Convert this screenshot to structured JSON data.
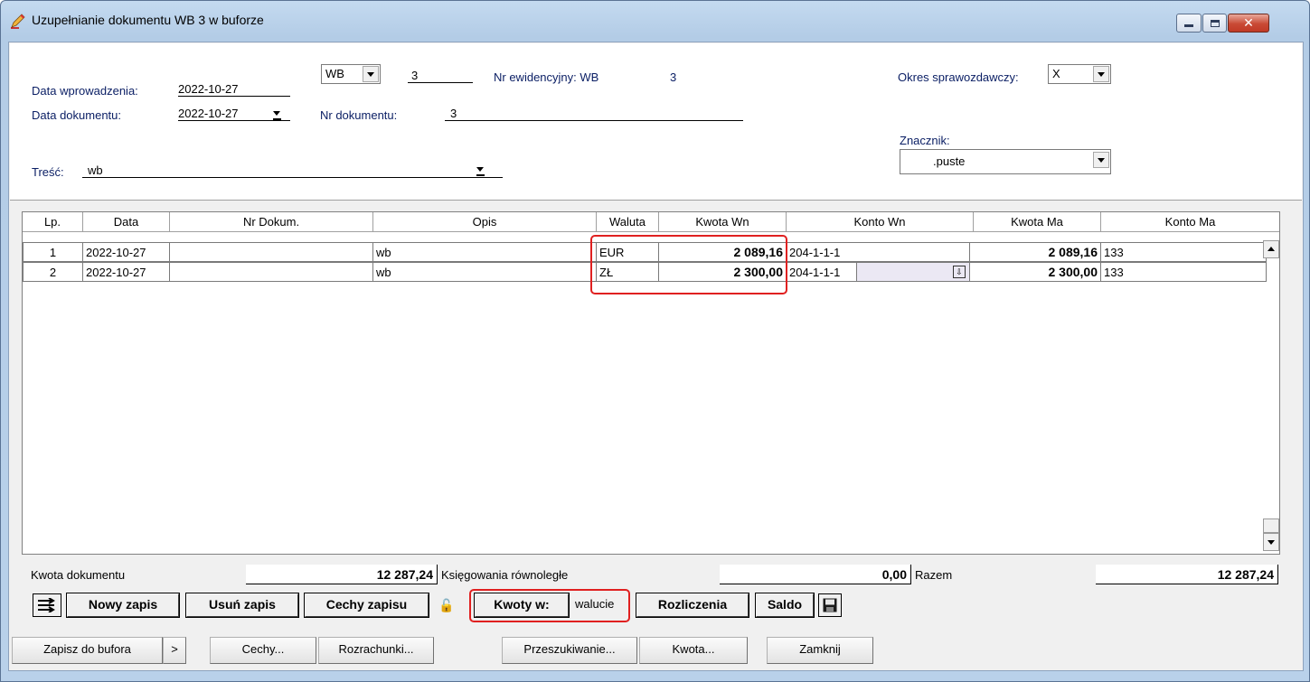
{
  "window": {
    "title": "Uzupełnianie dokumentu WB 3 w buforze"
  },
  "header": {
    "data_wprowadzenia_label": "Data wprowadzenia:",
    "data_wprowadzenia_value": "2022-10-27",
    "data_dokumentu_label": "Data dokumentu:",
    "data_dokumentu_value": "2022-10-27",
    "typ_value": "WB",
    "numer_value": "3",
    "nr_ewidencyjny_label": "Nr ewidencyjny: WB",
    "nr_ewidencyjny_value": "3",
    "nr_dokumentu_label": "Nr dokumentu:",
    "nr_dokumentu_value": "3",
    "okres_label": "Okres sprawozdawczy:",
    "okres_value": "X",
    "znacznik_label": "Znacznik:",
    "znacznik_value": ".puste",
    "tresc_label": "Treść:",
    "tresc_value": "wb"
  },
  "grid": {
    "columns": [
      "Lp.",
      "Data",
      "Nr Dokum.",
      "Opis",
      "Waluta",
      "Kwota Wn",
      "Konto Wn",
      "Kwota Ma",
      "Konto Ma"
    ],
    "rows": [
      {
        "lp": "1",
        "data": "2022-10-27",
        "nr": "",
        "opis": "wb",
        "waluta": "EUR",
        "kwota_wn": "2 089,16",
        "konto_wn": "204-1-1-1",
        "kwota_ma": "2 089,16",
        "konto_ma": "133"
      },
      {
        "lp": "2",
        "data": "2022-10-27",
        "nr": "",
        "opis": "wb",
        "waluta": "ZŁ",
        "kwota_wn": "2 300,00",
        "konto_wn": "204-1-1-1",
        "kwota_ma": "2 300,00",
        "konto_ma": "133"
      }
    ]
  },
  "totals": {
    "kwota_dokumentu_label": "Kwota dokumentu",
    "kwota_dokumentu_value": "12 287,24",
    "ksiegowania_label": "Księgowania równoległe",
    "ksiegowania_value": "0,00",
    "razem_label": "Razem",
    "razem_value": "12 287,24"
  },
  "toolbar": {
    "nowy_zapis": "Nowy zapis",
    "usun_zapis": "Usuń zapis",
    "cechy_zapisu": "Cechy zapisu",
    "kwoty_w": "Kwoty w:",
    "kwoty_w_value": "walucie",
    "rozliczenia": "Rozliczenia",
    "saldo": "Saldo"
  },
  "bottom": {
    "zapisz": "Zapisz do bufora",
    "more": ">",
    "cechy": "Cechy...",
    "rozrachunki": "Rozrachunki...",
    "przeszukiwanie": "Przeszukiwanie...",
    "kwota": "Kwota...",
    "zamknij": "Zamknij"
  },
  "colors": {
    "label_navy": "#0a1e64",
    "highlight_red": "#e02020",
    "selected_cell": "#ebe8f4"
  }
}
